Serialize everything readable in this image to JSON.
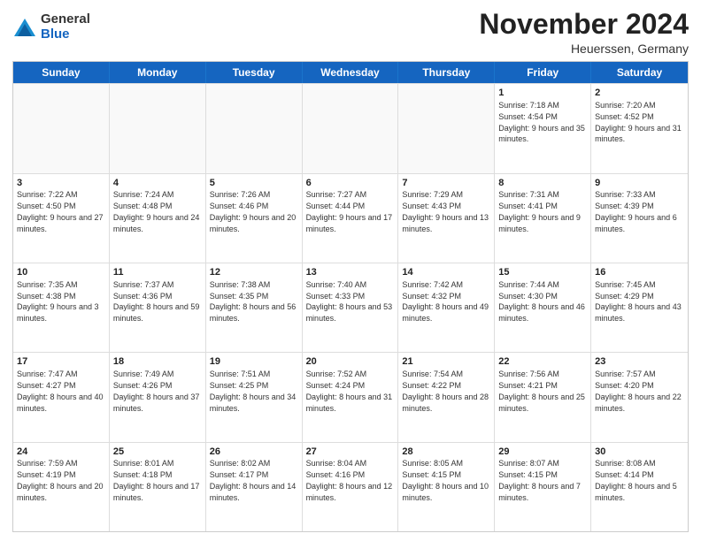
{
  "logo": {
    "general": "General",
    "blue": "Blue"
  },
  "header": {
    "title": "November 2024",
    "location": "Heuerssen, Germany"
  },
  "days": [
    "Sunday",
    "Monday",
    "Tuesday",
    "Wednesday",
    "Thursday",
    "Friday",
    "Saturday"
  ],
  "weeks": [
    [
      {
        "day": "",
        "info": "",
        "empty": true
      },
      {
        "day": "",
        "info": "",
        "empty": true
      },
      {
        "day": "",
        "info": "",
        "empty": true
      },
      {
        "day": "",
        "info": "",
        "empty": true
      },
      {
        "day": "",
        "info": "",
        "empty": true
      },
      {
        "day": "1",
        "info": "Sunrise: 7:18 AM\nSunset: 4:54 PM\nDaylight: 9 hours and 35 minutes.",
        "empty": false
      },
      {
        "day": "2",
        "info": "Sunrise: 7:20 AM\nSunset: 4:52 PM\nDaylight: 9 hours and 31 minutes.",
        "empty": false
      }
    ],
    [
      {
        "day": "3",
        "info": "Sunrise: 7:22 AM\nSunset: 4:50 PM\nDaylight: 9 hours and 27 minutes.",
        "empty": false
      },
      {
        "day": "4",
        "info": "Sunrise: 7:24 AM\nSunset: 4:48 PM\nDaylight: 9 hours and 24 minutes.",
        "empty": false
      },
      {
        "day": "5",
        "info": "Sunrise: 7:26 AM\nSunset: 4:46 PM\nDaylight: 9 hours and 20 minutes.",
        "empty": false
      },
      {
        "day": "6",
        "info": "Sunrise: 7:27 AM\nSunset: 4:44 PM\nDaylight: 9 hours and 17 minutes.",
        "empty": false
      },
      {
        "day": "7",
        "info": "Sunrise: 7:29 AM\nSunset: 4:43 PM\nDaylight: 9 hours and 13 minutes.",
        "empty": false
      },
      {
        "day": "8",
        "info": "Sunrise: 7:31 AM\nSunset: 4:41 PM\nDaylight: 9 hours and 9 minutes.",
        "empty": false
      },
      {
        "day": "9",
        "info": "Sunrise: 7:33 AM\nSunset: 4:39 PM\nDaylight: 9 hours and 6 minutes.",
        "empty": false
      }
    ],
    [
      {
        "day": "10",
        "info": "Sunrise: 7:35 AM\nSunset: 4:38 PM\nDaylight: 9 hours and 3 minutes.",
        "empty": false
      },
      {
        "day": "11",
        "info": "Sunrise: 7:37 AM\nSunset: 4:36 PM\nDaylight: 8 hours and 59 minutes.",
        "empty": false
      },
      {
        "day": "12",
        "info": "Sunrise: 7:38 AM\nSunset: 4:35 PM\nDaylight: 8 hours and 56 minutes.",
        "empty": false
      },
      {
        "day": "13",
        "info": "Sunrise: 7:40 AM\nSunset: 4:33 PM\nDaylight: 8 hours and 53 minutes.",
        "empty": false
      },
      {
        "day": "14",
        "info": "Sunrise: 7:42 AM\nSunset: 4:32 PM\nDaylight: 8 hours and 49 minutes.",
        "empty": false
      },
      {
        "day": "15",
        "info": "Sunrise: 7:44 AM\nSunset: 4:30 PM\nDaylight: 8 hours and 46 minutes.",
        "empty": false
      },
      {
        "day": "16",
        "info": "Sunrise: 7:45 AM\nSunset: 4:29 PM\nDaylight: 8 hours and 43 minutes.",
        "empty": false
      }
    ],
    [
      {
        "day": "17",
        "info": "Sunrise: 7:47 AM\nSunset: 4:27 PM\nDaylight: 8 hours and 40 minutes.",
        "empty": false
      },
      {
        "day": "18",
        "info": "Sunrise: 7:49 AM\nSunset: 4:26 PM\nDaylight: 8 hours and 37 minutes.",
        "empty": false
      },
      {
        "day": "19",
        "info": "Sunrise: 7:51 AM\nSunset: 4:25 PM\nDaylight: 8 hours and 34 minutes.",
        "empty": false
      },
      {
        "day": "20",
        "info": "Sunrise: 7:52 AM\nSunset: 4:24 PM\nDaylight: 8 hours and 31 minutes.",
        "empty": false
      },
      {
        "day": "21",
        "info": "Sunrise: 7:54 AM\nSunset: 4:22 PM\nDaylight: 8 hours and 28 minutes.",
        "empty": false
      },
      {
        "day": "22",
        "info": "Sunrise: 7:56 AM\nSunset: 4:21 PM\nDaylight: 8 hours and 25 minutes.",
        "empty": false
      },
      {
        "day": "23",
        "info": "Sunrise: 7:57 AM\nSunset: 4:20 PM\nDaylight: 8 hours and 22 minutes.",
        "empty": false
      }
    ],
    [
      {
        "day": "24",
        "info": "Sunrise: 7:59 AM\nSunset: 4:19 PM\nDaylight: 8 hours and 20 minutes.",
        "empty": false
      },
      {
        "day": "25",
        "info": "Sunrise: 8:01 AM\nSunset: 4:18 PM\nDaylight: 8 hours and 17 minutes.",
        "empty": false
      },
      {
        "day": "26",
        "info": "Sunrise: 8:02 AM\nSunset: 4:17 PM\nDaylight: 8 hours and 14 minutes.",
        "empty": false
      },
      {
        "day": "27",
        "info": "Sunrise: 8:04 AM\nSunset: 4:16 PM\nDaylight: 8 hours and 12 minutes.",
        "empty": false
      },
      {
        "day": "28",
        "info": "Sunrise: 8:05 AM\nSunset: 4:15 PM\nDaylight: 8 hours and 10 minutes.",
        "empty": false
      },
      {
        "day": "29",
        "info": "Sunrise: 8:07 AM\nSunset: 4:15 PM\nDaylight: 8 hours and 7 minutes.",
        "empty": false
      },
      {
        "day": "30",
        "info": "Sunrise: 8:08 AM\nSunset: 4:14 PM\nDaylight: 8 hours and 5 minutes.",
        "empty": false
      }
    ]
  ]
}
